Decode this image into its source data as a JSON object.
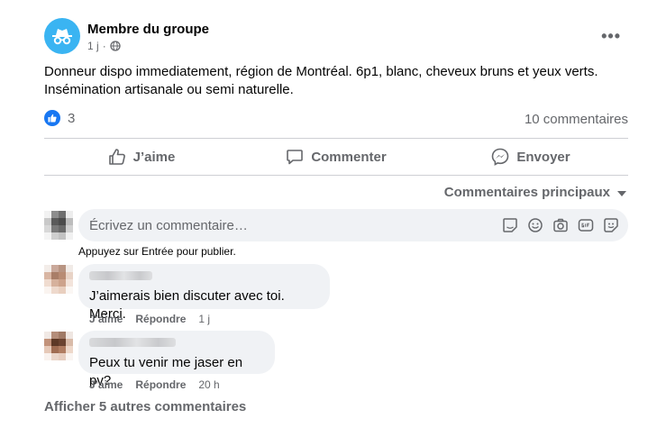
{
  "post": {
    "author": "Membre du groupe",
    "time": "1 j",
    "text_line1": "Donneur dispo immediatement, région de Montréal. 6p1, blanc, cheveux bruns et yeux verts.",
    "text_line2": "Insémination artisanale ou semi naturelle.",
    "reaction_count": "3",
    "comments_count": "10 commentaires"
  },
  "actions": {
    "like": "J’aime",
    "comment": "Commenter",
    "send": "Envoyer"
  },
  "sort_label": "Commentaires principaux",
  "composer": {
    "placeholder": "Écrivez un commentaire…",
    "hint": "Appuyez sur Entrée pour publier."
  },
  "comments": [
    {
      "text": "J’aimerais bien discuter avec toi. Merci.",
      "like": "J’aime",
      "reply": "Répondre",
      "time": "1 j"
    },
    {
      "text": "Peux tu venir me jaser en pv?",
      "like": "J’aime",
      "reply": "Répondre",
      "time": "20 h"
    }
  ],
  "more_comments": "Afficher 5 autres commentaires",
  "colors": {
    "group_avatar": "#3ab4f2",
    "like_blue": "#1877f2",
    "secondary_text": "#65676b",
    "bubble_bg": "#f0f2f5"
  },
  "icons": [
    "incognito-icon",
    "globe-icon",
    "more-icon",
    "like-icon",
    "comment-icon",
    "messenger-icon",
    "sticker-icon",
    "emoji-icon",
    "camera-icon",
    "gif-icon",
    "avatar-sticker-icon"
  ]
}
